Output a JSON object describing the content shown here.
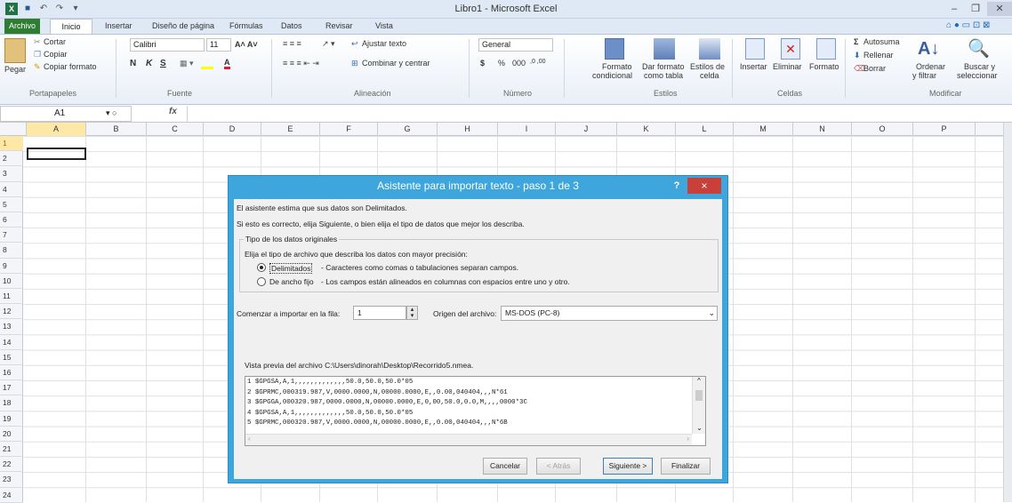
{
  "window": {
    "title": "Libro1 - Microsoft Excel"
  },
  "tabs": [
    "Archivo",
    "Inicio",
    "Insertar",
    "Diseño de página",
    "Fórmulas",
    "Datos",
    "Revisar",
    "Vista"
  ],
  "ribbon": {
    "paste": "Pegar",
    "cut": "Cortar",
    "copy": "Copiar",
    "copy_format": "Copiar formato",
    "group_clipboard": "Portapapeles",
    "font_name": "Calibri",
    "font_size": "11",
    "bold": "N",
    "italic": "K",
    "underline": "S",
    "group_font": "Fuente",
    "wrap_text": "Ajustar texto",
    "merge": "Combinar y centrar",
    "group_align": "Alineación",
    "number_format": "General",
    "currency": "$",
    "percent": "%",
    "thousands": "000",
    "dec_inc": ",0 ,00",
    "dec_dec": ",00 ,0",
    "group_number": "Número",
    "cond_format_1": "Formato",
    "cond_format_2": "condicional",
    "table_format_1": "Dar formato",
    "table_format_2": "como tabla",
    "cell_styles_1": "Estilos de",
    "cell_styles_2": "celda",
    "group_styles": "Estilos",
    "insert": "Insertar",
    "delete": "Eliminar",
    "format": "Formato",
    "group_cells": "Celdas",
    "autosum": "Autosuma",
    "fill": "Rellenar",
    "clear": "Borrar",
    "sort_1": "Ordenar",
    "sort_2": "y filtrar",
    "find_1": "Buscar y",
    "find_2": "seleccionar",
    "group_edit": "Modificar"
  },
  "formula_bar": {
    "name_box": "A1",
    "fx": "fx",
    "value": ""
  },
  "columns": [
    "A",
    "B",
    "C",
    "D",
    "E",
    "F",
    "G",
    "H",
    "I",
    "J",
    "K",
    "L",
    "M",
    "N",
    "O",
    "P"
  ],
  "rows": [
    "1",
    "2",
    "3",
    "4",
    "5",
    "6",
    "7",
    "8",
    "9",
    "10",
    "11",
    "12",
    "13",
    "14",
    "15",
    "16",
    "17",
    "18",
    "19",
    "20",
    "21",
    "22",
    "23",
    "24"
  ],
  "dialog": {
    "title": "Asistente para importar texto - paso 1 de 3",
    "help": "?",
    "close": "×",
    "line1": "El asistente estima que sus datos son Delimitados.",
    "line2": "Si esto es correcto, elija Siguiente, o bien elija el tipo de datos que mejor los describa.",
    "group_title": "Tipo de los datos originales",
    "group_prompt": "Elija el tipo de archivo que describa los datos con mayor precisión:",
    "opt_delim": "Delimitados",
    "opt_delim_desc": "- Caracteres como comas o tabulaciones separan campos.",
    "opt_fixed": "De ancho fijo",
    "opt_fixed_desc": "- Los campos están alineados en columnas con espacios entre uno y otro.",
    "start_label": "Comenzar a importar en la fila:",
    "start_value": "1",
    "origin_label": "Origen del archivo:",
    "origin_value": "MS-DOS (PC-8)",
    "preview_label": "Vista previa del archivo C:\\Users\\dinorah\\Desktop\\Recorrido5.nmea.",
    "preview": [
      "1 $GPGSA,A,1,,,,,,,,,,,,,50.0,50.0,50.0*05",
      "2 $GPRMC,000319.987,V,0000.0000,N,00000.0000,E,,0.00,040404,,,N*61",
      "3 $GPGGA,000320.987,0000.0000,N,00000.0000,E,0,00,50.0,0.0,M,,,,0000*3C",
      "4 $GPGSA,A,1,,,,,,,,,,,,,50.0,50.0,50.0*05",
      "5 $GPRMC,000320.987,V,0000.0000,N,00000.0000,E,,0.00,040404,,,N*6B"
    ],
    "btn_cancel": "Cancelar",
    "btn_back": "< Atrás",
    "btn_next": "Siguiente >",
    "btn_finish": "Finalizar"
  }
}
